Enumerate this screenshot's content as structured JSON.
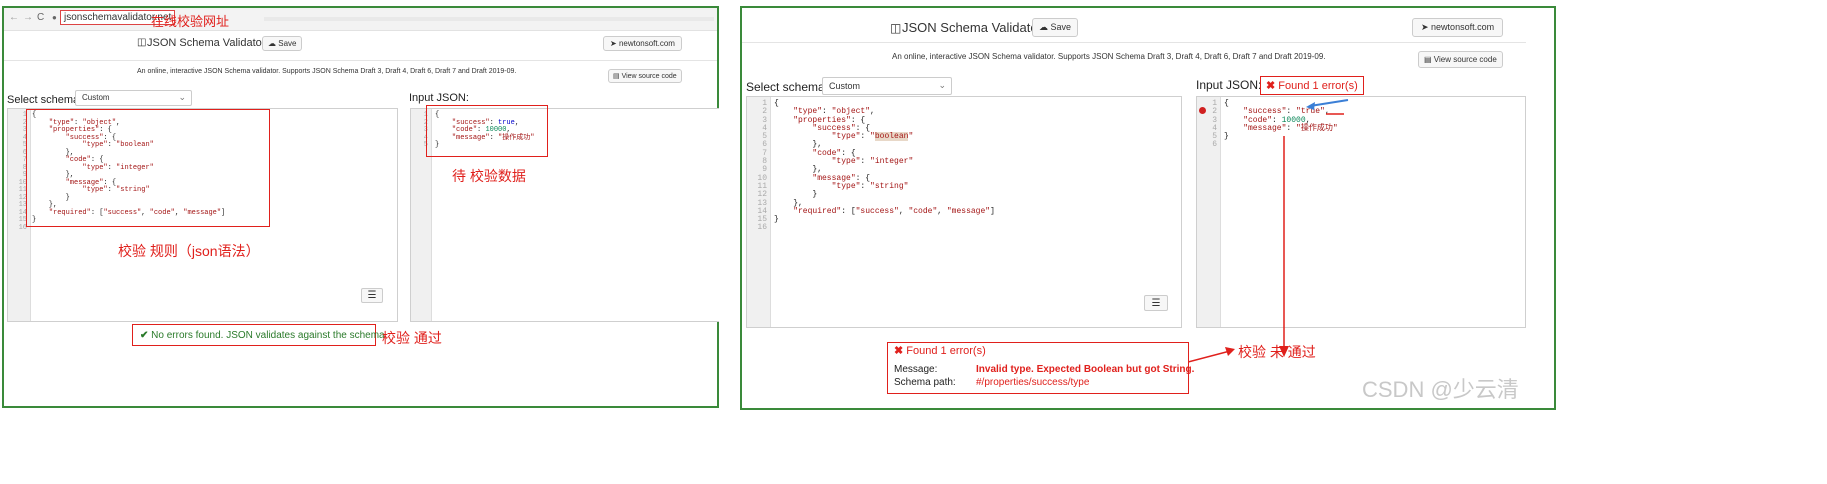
{
  "left": {
    "browser_url": "jsonschemavalidator.net",
    "nav_back": "←",
    "nav_forward": "→",
    "nav_reload": "C",
    "url_note": "在线校验网址",
    "app_title": "JSON Schema Validator",
    "save_label": "Save",
    "site_link": "newtonsoft.com",
    "subtitle": "An online, interactive JSON Schema validator. Supports JSON Schema Draft 3, Draft 4, Draft 6, Draft 7 and Draft 2019-09.",
    "view_source": "View source code",
    "select_schema_label": "Select schema:",
    "schema_value": "Custom",
    "input_json_label": "Input JSON:",
    "schema_note": "校验 规则（json语法）",
    "input_note": "待 校验数据",
    "result_text": "No errors found. JSON validates against the schema",
    "result_note": "校验 通过",
    "format_icon": "☰"
  },
  "right": {
    "app_title": "JSON Schema Validator",
    "save_label": "Save",
    "site_link": "newtonsoft.com",
    "subtitle": "An online, interactive JSON Schema validator. Supports JSON Schema Draft 3, Draft 4, Draft 6, Draft 7 and Draft 2019-09.",
    "view_source": "View source code",
    "select_schema_label": "Select schema:",
    "schema_value": "Custom",
    "input_json_label": "Input JSON:",
    "error_badge": "Found 1 error(s)",
    "error_title": "Found 1 error(s)",
    "message_label": "Message:",
    "message_value": "Invalid type. Expected Boolean but got String.",
    "schema_path_label": "Schema path:",
    "schema_path_value": "#/properties/success/type",
    "fail_note": "校验 未 通过",
    "format_icon": "☰"
  },
  "watermark": "CSDN @少云清",
  "colors": {
    "frame": "#3a8a3a",
    "annotation": "#e0201c",
    "success": "#2a7a2a"
  },
  "icons": [
    "shield-icon",
    "cloud-save-icon",
    "send-icon",
    "document-icon",
    "check-icon",
    "cross-icon",
    "error-dot-icon",
    "lock-icon"
  ]
}
